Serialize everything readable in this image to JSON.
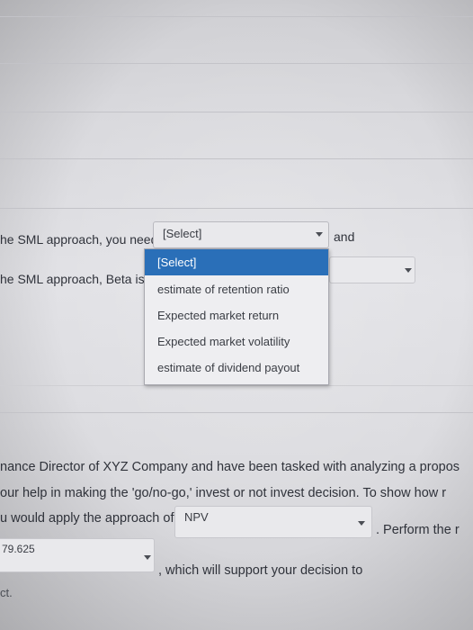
{
  "questions": {
    "q1_prefix": "he SML approach, you need",
    "q1_select_value": "[Select]",
    "q1_suffix": "and",
    "q2_prefix": "he SML approach, Beta is ar",
    "dropdown_options": [
      "[Select]",
      "estimate of retention ratio",
      "Expected market return",
      "Expected market volatility",
      "estimate of dividend payout"
    ]
  },
  "paragraph": {
    "line1": "nance Director of XYZ Company and have been tasked with analyzing a propos",
    "line2": "our help in making the 'go/no-go,' invest or not invest decision. To show how r",
    "line3_prefix": "u would apply the approach of",
    "line3_select_value": "NPV",
    "line3_suffix": ". Perform the r",
    "line4_select_value": "79.625",
    "line4_suffix": ", which will support your decision to",
    "line5": "ct."
  }
}
